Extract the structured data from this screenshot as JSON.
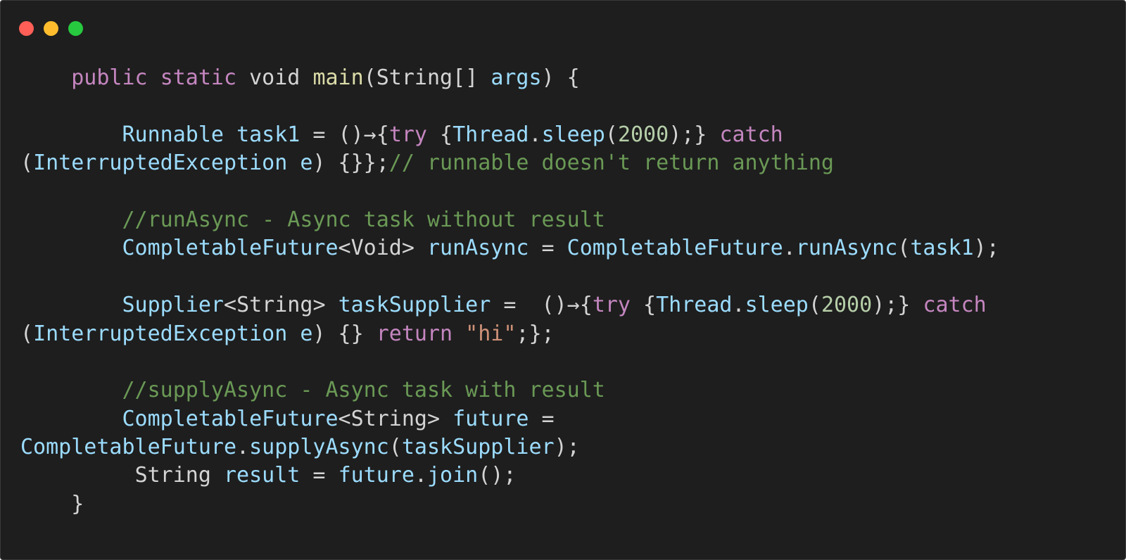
{
  "window": {
    "buttons": [
      "close",
      "minimize",
      "zoom"
    ],
    "colors": {
      "background": "#1e1e1e",
      "close": "#ff5f56",
      "minimize": "#ffbd2e",
      "zoom": "#27c93f"
    }
  },
  "code": {
    "language": "java",
    "lines": [
      [
        [
          "pl",
          "    "
        ],
        [
          "kw",
          "public"
        ],
        [
          "pl",
          " "
        ],
        [
          "kw",
          "static"
        ],
        [
          "pl",
          " "
        ],
        [
          "pl",
          "void"
        ],
        [
          "pl",
          " "
        ],
        [
          "fn",
          "main"
        ],
        [
          "pn",
          "("
        ],
        [
          "pl",
          "String"
        ],
        [
          "pn",
          "[] "
        ],
        [
          "vr",
          "args"
        ],
        [
          "pn",
          ") {"
        ]
      ],
      [],
      [
        [
          "pl",
          "        "
        ],
        [
          "ty",
          "Runnable"
        ],
        [
          "pl",
          " "
        ],
        [
          "vr",
          "task1"
        ],
        [
          "pn",
          " = ()→{"
        ],
        [
          "kw",
          "try"
        ],
        [
          "pn",
          " {"
        ],
        [
          "ty",
          "Thread"
        ],
        [
          "pn",
          "."
        ],
        [
          "ty",
          "sleep"
        ],
        [
          "pn",
          "("
        ],
        [
          "nm",
          "2000"
        ],
        [
          "pn",
          ");} "
        ],
        [
          "kw",
          "catch"
        ]
      ],
      [
        [
          "pn",
          "("
        ],
        [
          "ty",
          "InterruptedException"
        ],
        [
          "pl",
          " "
        ],
        [
          "vr",
          "e"
        ],
        [
          "pn",
          ") {}};"
        ],
        [
          "cm",
          "// runnable doesn't return anything"
        ]
      ],
      [],
      [
        [
          "pl",
          "        "
        ],
        [
          "cm",
          "//runAsync - Async task without result"
        ]
      ],
      [
        [
          "pl",
          "        "
        ],
        [
          "ty",
          "CompletableFuture"
        ],
        [
          "pn",
          "<"
        ],
        [
          "pl",
          "Void"
        ],
        [
          "pn",
          "> "
        ],
        [
          "vr",
          "runAsync"
        ],
        [
          "pn",
          " = "
        ],
        [
          "ty",
          "CompletableFuture"
        ],
        [
          "pn",
          "."
        ],
        [
          "ty",
          "runAsync"
        ],
        [
          "pn",
          "("
        ],
        [
          "vr",
          "task1"
        ],
        [
          "pn",
          ");"
        ]
      ],
      [],
      [
        [
          "pl",
          "        "
        ],
        [
          "ty",
          "Supplier"
        ],
        [
          "pn",
          "<"
        ],
        [
          "pl",
          "String"
        ],
        [
          "pn",
          "> "
        ],
        [
          "vr",
          "taskSupplier"
        ],
        [
          "pn",
          " =  ()→{"
        ],
        [
          "kw",
          "try"
        ],
        [
          "pn",
          " {"
        ],
        [
          "ty",
          "Thread"
        ],
        [
          "pn",
          "."
        ],
        [
          "ty",
          "sleep"
        ],
        [
          "pn",
          "("
        ],
        [
          "nm",
          "2000"
        ],
        [
          "pn",
          ");} "
        ],
        [
          "kw",
          "catch"
        ]
      ],
      [
        [
          "pn",
          "("
        ],
        [
          "ty",
          "InterruptedException"
        ],
        [
          "pl",
          " "
        ],
        [
          "vr",
          "e"
        ],
        [
          "pn",
          ") {} "
        ],
        [
          "kw",
          "return"
        ],
        [
          "pl",
          " "
        ],
        [
          "st",
          "\"hi\""
        ],
        [
          "pn",
          ";};"
        ]
      ],
      [],
      [
        [
          "pl",
          "        "
        ],
        [
          "cm",
          "//supplyAsync - Async task with result"
        ]
      ],
      [
        [
          "pl",
          "        "
        ],
        [
          "ty",
          "CompletableFuture"
        ],
        [
          "pn",
          "<"
        ],
        [
          "pl",
          "String"
        ],
        [
          "pn",
          "> "
        ],
        [
          "vr",
          "future"
        ],
        [
          "pn",
          " ="
        ]
      ],
      [
        [
          "ty",
          "CompletableFuture"
        ],
        [
          "pn",
          "."
        ],
        [
          "ty",
          "supplyAsync"
        ],
        [
          "pn",
          "("
        ],
        [
          "vr",
          "taskSupplier"
        ],
        [
          "pn",
          ");"
        ]
      ],
      [
        [
          "pl",
          "         "
        ],
        [
          "pl",
          "String"
        ],
        [
          "pl",
          " "
        ],
        [
          "vr",
          "result"
        ],
        [
          "pn",
          " = "
        ],
        [
          "vr",
          "future"
        ],
        [
          "pn",
          "."
        ],
        [
          "ty",
          "join"
        ],
        [
          "pn",
          "();"
        ]
      ],
      [
        [
          "pl",
          "    "
        ],
        [
          "pn",
          "}"
        ]
      ]
    ]
  }
}
